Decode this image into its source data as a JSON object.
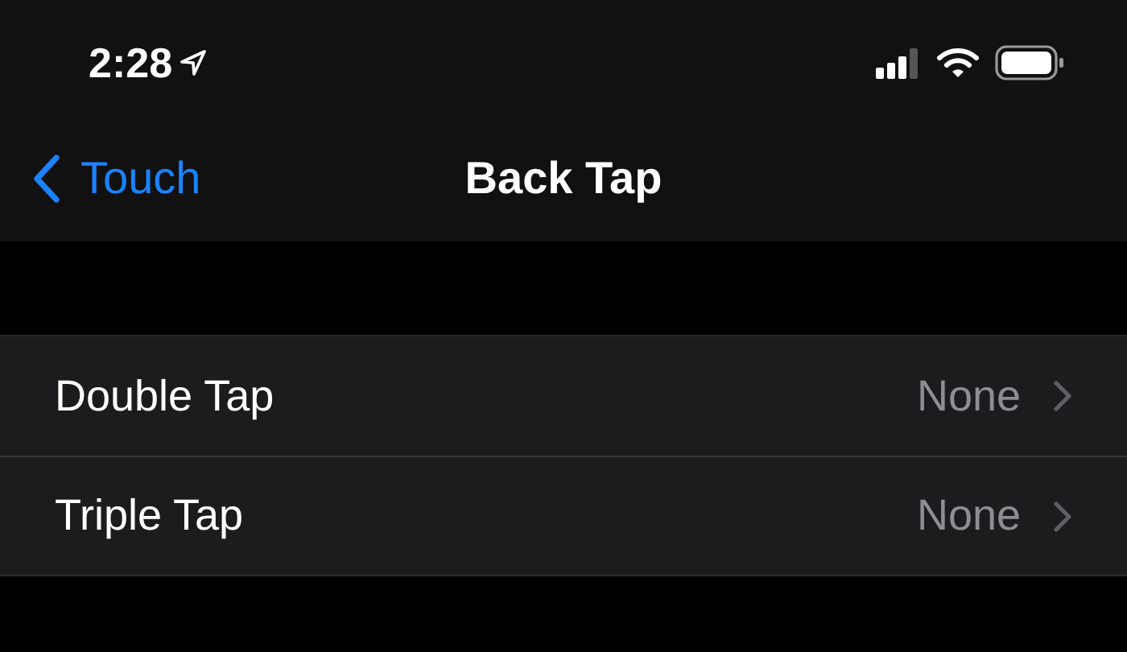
{
  "status_bar": {
    "time": "2:28"
  },
  "nav_bar": {
    "back_label": "Touch",
    "title": "Back Tap"
  },
  "rows": [
    {
      "label": "Double Tap",
      "value": "None"
    },
    {
      "label": "Triple Tap",
      "value": "None"
    }
  ]
}
